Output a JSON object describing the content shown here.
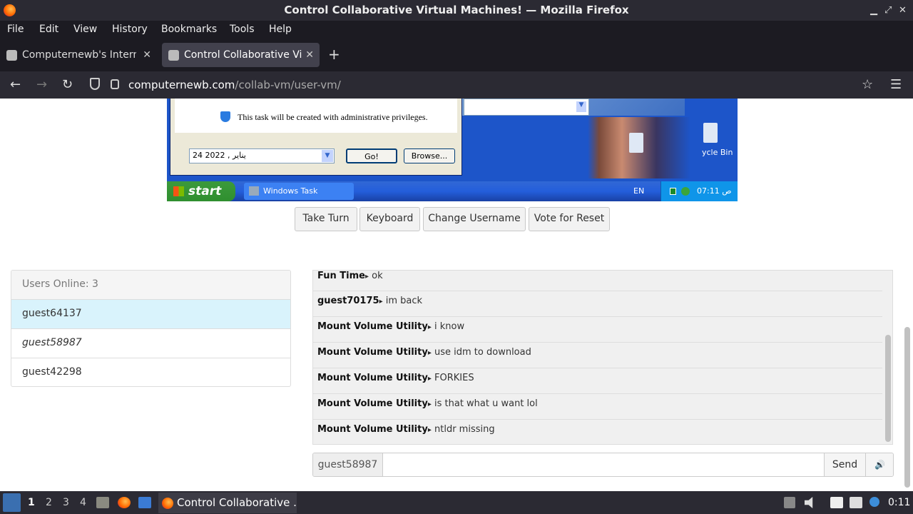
{
  "window": {
    "title": "Control Collaborative Virtual Machines! — Mozilla Firefox",
    "controls": [
      "▁",
      "⤢",
      "✕"
    ]
  },
  "menu": [
    "File",
    "Edit",
    "View",
    "History",
    "Bookmarks",
    "Tools",
    "Help"
  ],
  "tabs": [
    {
      "label": "Computernewb's Internet",
      "active": false
    },
    {
      "label": "Control Collaborative Virt",
      "active": true
    }
  ],
  "tab_close": "✕",
  "new_tab": "+",
  "nav": {
    "back": "←",
    "forward": "→",
    "reload": "↻",
    "url_domain": "computernewb.com",
    "url_path": "/collab-vm/user-vm/",
    "bookmark": "☆",
    "menu": "☰"
  },
  "vm": {
    "dialog_note": "This task will be created with administrative privileges.",
    "date_value": "24      يناير     , 2022",
    "go_button": "Go!",
    "browse_button": "Browse...",
    "recycle_label": "ycle Bin",
    "start_label": "start",
    "taskbar_item": "Windows Task Manager",
    "lang": "EN",
    "clock": "07:11 ص",
    "dropdown_arrow": "▼"
  },
  "vm_buttons": [
    "Take Turn",
    "Keyboard",
    "Change Username",
    "Vote for Reset"
  ],
  "users": {
    "header": "Users Online: 3",
    "list": [
      {
        "name": "guest64137",
        "selected": true,
        "me": false
      },
      {
        "name": "guest58987",
        "selected": false,
        "me": true
      },
      {
        "name": "guest42298",
        "selected": false,
        "me": false
      }
    ]
  },
  "chat": [
    {
      "user": "Fun Time",
      "msg": "ok"
    },
    {
      "user": "guest70175",
      "msg": "im back"
    },
    {
      "user": "Mount Volume Utility",
      "msg": "i know"
    },
    {
      "user": "Mount Volume Utility",
      "msg": "use idm to download"
    },
    {
      "user": "Mount Volume Utility",
      "msg": "FORKIES"
    },
    {
      "user": "Mount Volume Utility",
      "msg": "is that what u want lol"
    },
    {
      "user": "Mount Volume Utility",
      "msg": "ntldr missing"
    }
  ],
  "chat_sep": "▸",
  "chat_input": {
    "username": "guest58987",
    "value": "",
    "send": "Send",
    "volume": "🔊"
  },
  "taskbar": {
    "workspaces": [
      "1",
      "2",
      "3",
      "4"
    ],
    "app": "Control Collaborative ...",
    "clock": "0:11"
  }
}
